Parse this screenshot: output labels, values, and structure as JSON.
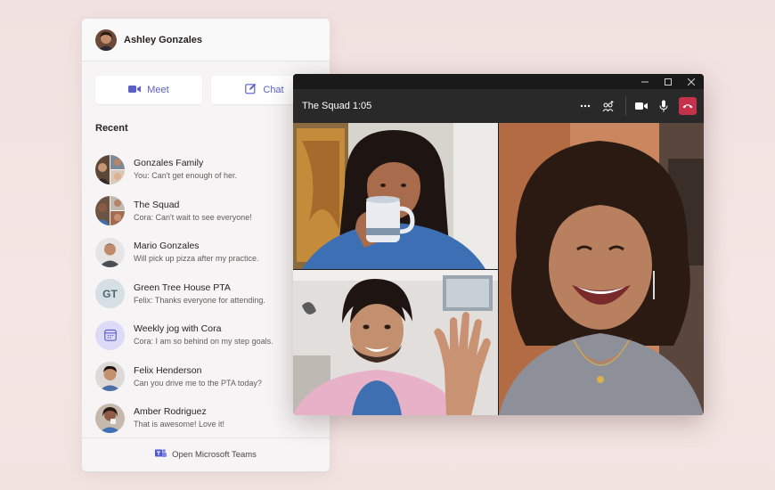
{
  "user": {
    "name": "Ashley Gonzales"
  },
  "actions": {
    "meet_label": "Meet",
    "chat_label": "Chat"
  },
  "recent": {
    "title": "Recent",
    "items": [
      {
        "name": "Gonzales Family",
        "preview": "You: Can't get enough of her.",
        "avatar": "group-photo"
      },
      {
        "name": "The Squad",
        "preview": "Cora: Can't wait to see everyone!",
        "avatar": "group-photo"
      },
      {
        "name": "Mario Gonzales",
        "preview": "Will pick up pizza after my practice.",
        "avatar": "person-photo"
      },
      {
        "name": "Green Tree House PTA",
        "preview": "Felix: Thanks everyone for attending.",
        "avatar": "initials",
        "initials": "GT"
      },
      {
        "name": "Weekly jog with Cora",
        "preview": "Cora: I am so behind on my step goals.",
        "avatar": "calendar-icon"
      },
      {
        "name": "Felix Henderson",
        "preview": "Can you drive me to the PTA today?",
        "avatar": "person-photo"
      },
      {
        "name": "Amber Rodriguez",
        "preview": "That is awesome! Love it!",
        "avatar": "person-photo"
      }
    ]
  },
  "footer": {
    "label": "Open Microsoft Teams"
  },
  "call": {
    "title": "The Squad 1:05",
    "controls": [
      "more-options-icon",
      "add-people-icon",
      "video-camera-icon",
      "microphone-icon",
      "hang-up-icon"
    ]
  },
  "colors": {
    "accent": "#5b5fc7",
    "hangup": "#c4314b",
    "call_bg": "#292929"
  }
}
